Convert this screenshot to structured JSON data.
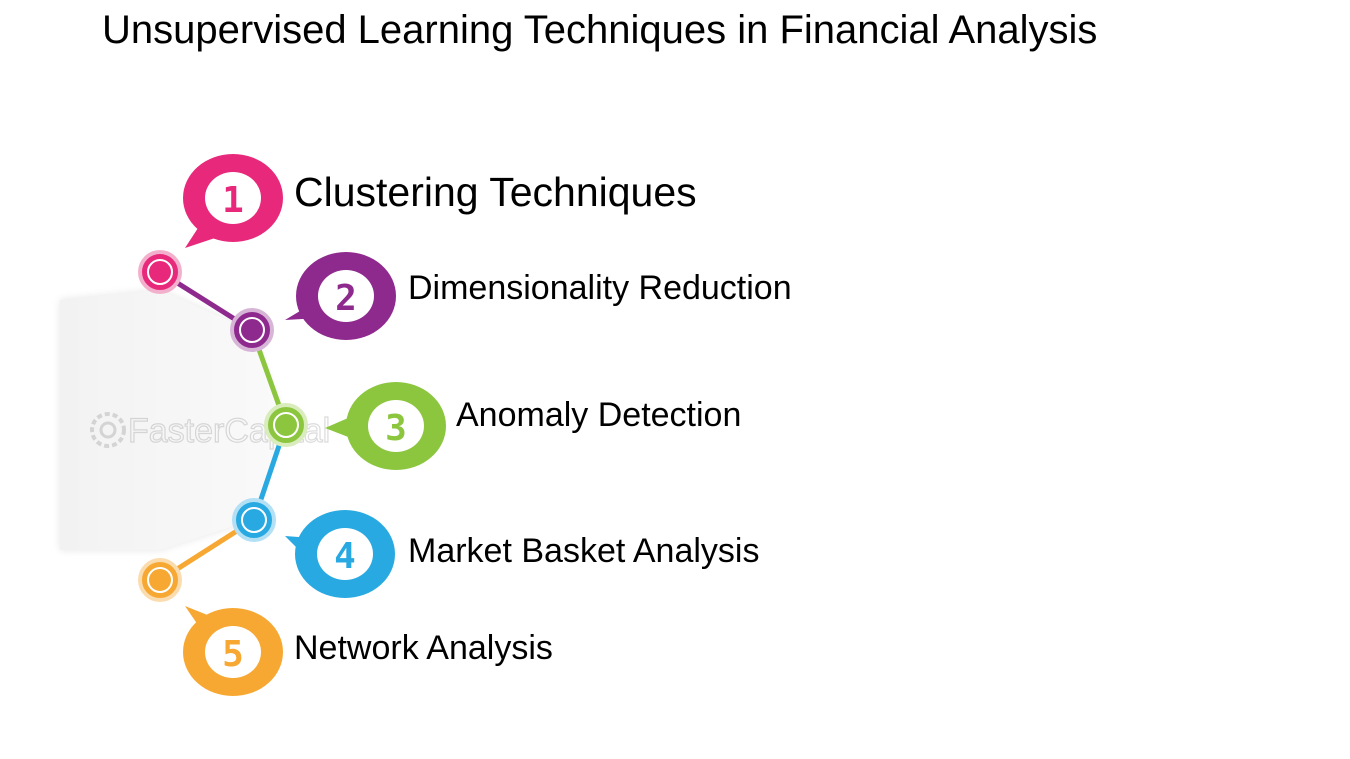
{
  "title": "Unsupervised Learning Techniques in Financial Analysis",
  "watermark": "FasterCapital",
  "steps": [
    {
      "number": "1",
      "label": "Clustering Techniques",
      "color": "#e8287a"
    },
    {
      "number": "2",
      "label": "Dimensionality Reduction",
      "color": "#8e2a8e"
    },
    {
      "number": "3",
      "label": "Anomaly Detection",
      "color": "#8cc63f"
    },
    {
      "number": "4",
      "label": "Market Basket Analysis",
      "color": "#29a9e1"
    },
    {
      "number": "5",
      "label": "Network Analysis",
      "color": "#f7a833"
    }
  ]
}
